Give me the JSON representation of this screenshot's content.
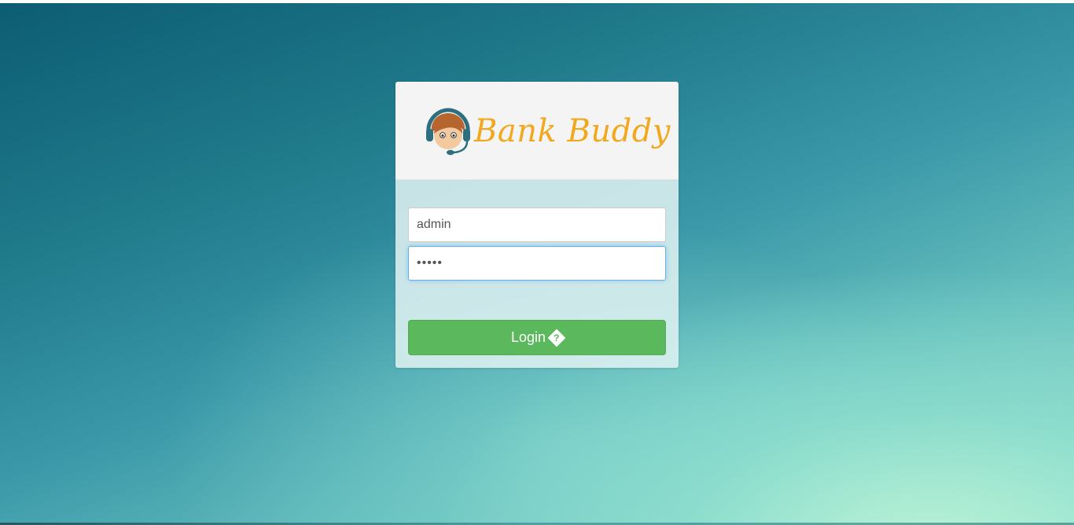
{
  "brand": {
    "name": "Bank Buddy",
    "logo_icon": "support-agent-headset-icon",
    "text_color": "#f2a81c"
  },
  "login_form": {
    "username_value": "admin",
    "password_value": "•••••",
    "login_label": "Login",
    "login_icon": "sign-in-icon",
    "button_color": "#5cb85c"
  }
}
